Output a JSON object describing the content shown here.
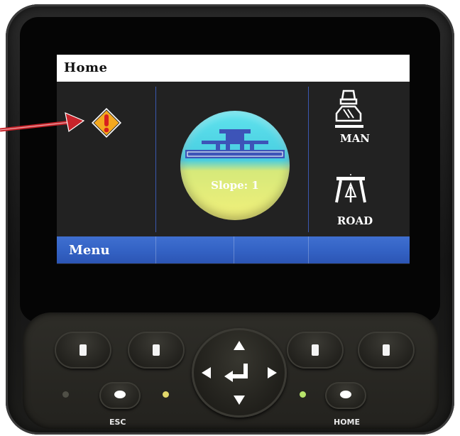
{
  "screen": {
    "title": "Home",
    "center": {
      "slope_text": "Slope:  1"
    },
    "right_buttons": [
      {
        "label": "MAN",
        "icon": "paver-icon"
      },
      {
        "label": "ROAD",
        "icon": "road-icon"
      }
    ],
    "left": {
      "icon": "warning-icon"
    },
    "menu_bar": {
      "label": "Menu"
    }
  },
  "keypad": {
    "esc_label": "ESC",
    "home_label": "HOME"
  },
  "colors": {
    "menu_blue": "#3463c5",
    "divider_blue": "#3a58b0",
    "warning_orange": "#f4a81f",
    "warning_red": "#d81f1f",
    "callout_arrow": "#c8232a",
    "led_green": "#b7e36a",
    "led_yellow": "#e2d86a"
  }
}
